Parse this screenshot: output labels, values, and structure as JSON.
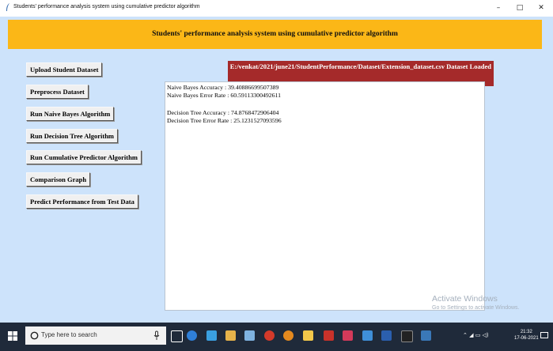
{
  "window": {
    "title": "Students' performance analysis system using cumulative predictor algorithm",
    "minimize": "–",
    "maximize": "□",
    "close": "✕"
  },
  "header": {
    "heading": "Students' performance analysis system using cumulative predictor algorithm"
  },
  "buttons": {
    "upload": "Upload Student Dataset",
    "preprocess": "Preprocess Dataset",
    "naive_bayes": "Run Naive Bayes Algorithm",
    "decision_tree": "Run Decision Tree Algorithm",
    "cumulative": "Run Cumulative Predictor Algorithm",
    "comparison": "Comparison Graph",
    "predict": "Predict Performance from Test Data"
  },
  "status": {
    "message": "E:/venkat/2021/june21/StudentPerformance/Dataset/Extension_dataset.csv Dataset Loaded"
  },
  "output": {
    "lines": [
      "Naive Bayes Accuracy  : 39.40886699507389",
      "Naive Bayes Error Rate : 60.59113300492611",
      "Decision Tree Accuracy  : 74.8768472906404",
      "Decision Tree Error Rate : 25.1231527093596"
    ]
  },
  "watermark": {
    "title": "Activate Windows",
    "subtitle": "Go to Settings to activate Windows."
  },
  "taskbar": {
    "search_placeholder": "Type here to search",
    "time": "21:32",
    "date": "17-06-2021"
  },
  "colors": {
    "header_band": "#fbb717",
    "client_bg": "#cde3fb",
    "status_bg": "#a52a2a",
    "taskbar_bg": "#1f2a3a"
  }
}
